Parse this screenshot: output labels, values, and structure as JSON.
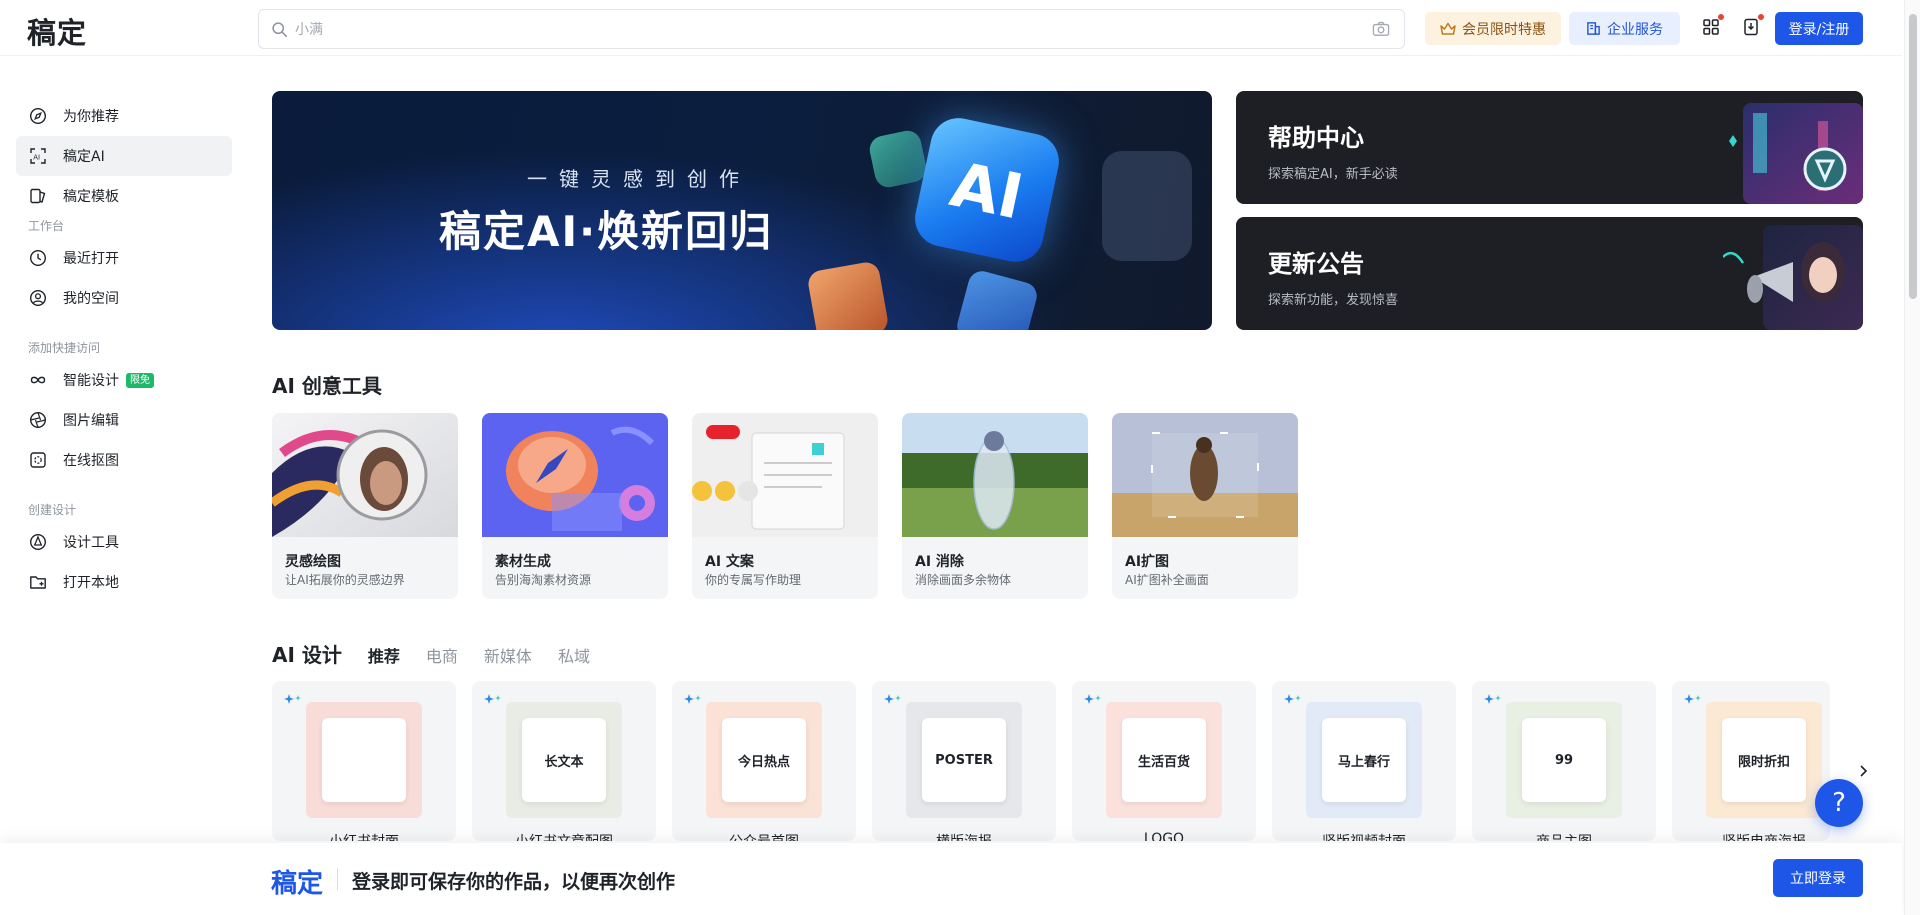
{
  "header": {
    "logo": "稿定",
    "search_placeholder": "小满",
    "vip_label": "会员限时特惠",
    "enterprise_label": "企业服务",
    "login_label": "登录/注册"
  },
  "sidebar": {
    "items_top": [
      {
        "label": "为你推荐",
        "icon": "compass-icon"
      },
      {
        "label": "稿定AI",
        "icon": "ai-scan-icon"
      },
      {
        "label": "稿定模板",
        "icon": "template-icon"
      }
    ],
    "section_workspace": "工作台",
    "items_workspace": [
      {
        "label": "最近打开",
        "icon": "clock-icon"
      },
      {
        "label": "我的空间",
        "icon": "user-circle-icon"
      }
    ],
    "section_quick": "添加快捷访问",
    "items_quick": [
      {
        "label": "智能设计",
        "icon": "infinity-icon",
        "badge": "限免"
      },
      {
        "label": "图片编辑",
        "icon": "aperture-icon"
      },
      {
        "label": "在线抠图",
        "icon": "cutout-icon"
      }
    ],
    "section_create": "创建设计",
    "items_create": [
      {
        "label": "设计工具",
        "icon": "pen-tool-icon"
      },
      {
        "label": "打开本地",
        "icon": "folder-plus-icon"
      }
    ]
  },
  "banner": {
    "subtitle": "一键灵感到创作",
    "title": "稿定AI·焕新回归",
    "cube_text": "AI"
  },
  "side_cards": [
    {
      "title": "帮助中心",
      "desc": "探索稿定AI，新手必读"
    },
    {
      "title": "更新公告",
      "desc": "探索新功能，发现惊喜"
    }
  ],
  "ai_tools": {
    "title": "AI 创意工具",
    "items": [
      {
        "name": "灵感绘图",
        "desc": "让AI拓展你的灵感边界"
      },
      {
        "name": "素材生成",
        "desc": "告别海淘素材资源"
      },
      {
        "name": "AI 文案",
        "desc": "你的专属写作助理"
      },
      {
        "name": "AI 消除",
        "desc": "消除画面多余物体"
      },
      {
        "name": "AI扩图",
        "desc": "AI扩图补全画面"
      }
    ]
  },
  "ai_design": {
    "title": "AI 设计",
    "tabs": [
      "推荐",
      "电商",
      "新媒体",
      "私域"
    ],
    "active_tab": "推荐",
    "cards": [
      {
        "label": "小红书封面",
        "thumb_text": "",
        "color": "#f8dcd8"
      },
      {
        "label": "小红书文章配图",
        "thumb_text": "长文本",
        "color": "#e8ece4"
      },
      {
        "label": "公众号首图",
        "thumb_text": "今日热点",
        "color": "#fbe2d6"
      },
      {
        "label": "横版海报",
        "thumb_text": "POSTER",
        "color": "#e6e7ea"
      },
      {
        "label": "LOGO",
        "thumb_text": "生活百货",
        "color": "#fbe1dc"
      },
      {
        "label": "竖版视频封面",
        "thumb_text": "马上春行",
        "color": "#e2e9f7"
      },
      {
        "label": "商品主图",
        "thumb_text": "99",
        "color": "#e8efe3"
      },
      {
        "label": "竖版电商海报",
        "thumb_text": "限时折扣",
        "color": "#fbe9d3"
      }
    ]
  },
  "bottom_bar": {
    "logo": "稿定",
    "message": "登录即可保存你的作品，以便再次创作",
    "button": "立即登录"
  },
  "help_float": "?"
}
